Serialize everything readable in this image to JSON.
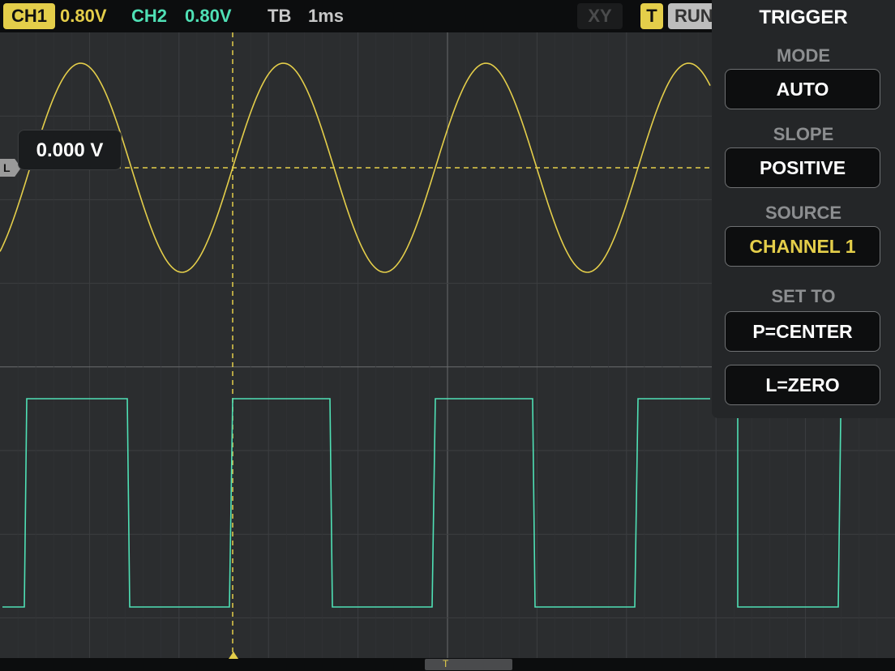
{
  "colors": {
    "ch1": "#e4ce4a",
    "ch2": "#4fe0b5",
    "panel_bg": "#242628",
    "screen_bg": "#2b2d2f"
  },
  "topbar": {
    "ch1_badge": "CH1",
    "ch1_volts": "0.80V",
    "ch2_label": "CH2",
    "ch2_volts": "0.80V",
    "tb_label": "TB",
    "tb_value": "1ms",
    "xy_button": "XY",
    "trigger_badge": "T",
    "run_button": "RUN"
  },
  "scope": {
    "level_tag": "L",
    "level_readout": "0.000 V",
    "trigger_position_marker": "T"
  },
  "trigger_panel": {
    "title": "TRIGGER",
    "mode_label": "MODE",
    "mode_value": "AUTO",
    "slope_label": "SLOPE",
    "slope_value": "POSITIVE",
    "source_label": "SOURCE",
    "source_value": "CHANNEL 1",
    "set_to_label": "SET TO",
    "p_center_button": "P=CENTER",
    "l_zero_button": "L=ZERO"
  }
}
